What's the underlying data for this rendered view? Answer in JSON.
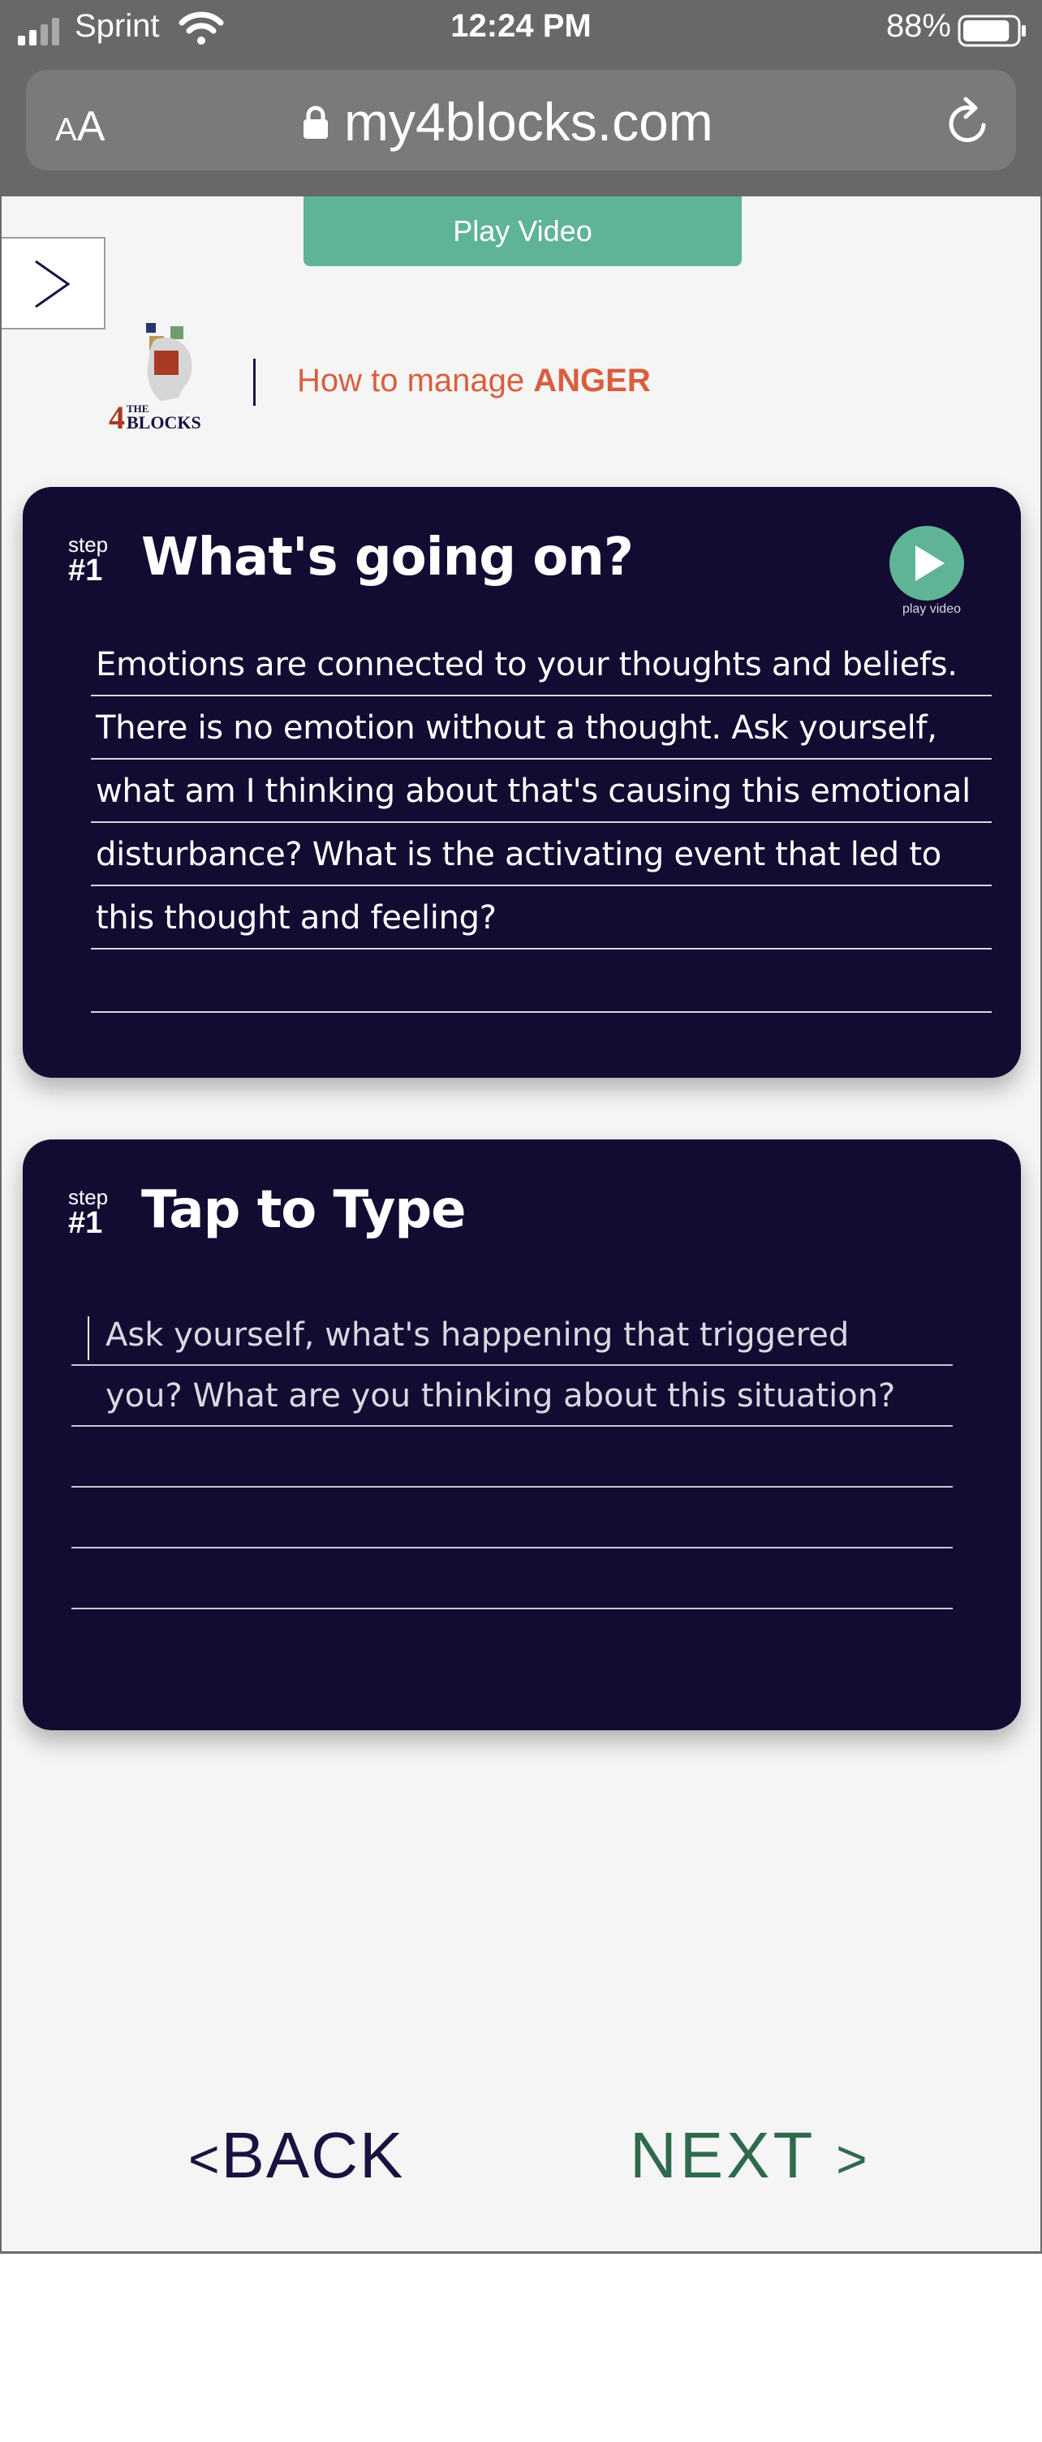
{
  "status_bar": {
    "carrier": "Sprint",
    "time": "12:24 PM",
    "battery_percent": "88%",
    "battery_level": 0.88,
    "signal_icon": "signal-bars-icon",
    "wifi_icon": "wifi-icon",
    "battery_icon": "battery-icon"
  },
  "browser": {
    "text_size_label_small": "A",
    "text_size_label_big": "A",
    "url": "my4blocks.com",
    "lock_icon": "lock-icon",
    "reload_icon": "reload-icon"
  },
  "page": {
    "play_video_label": "Play Video",
    "menu_toggle_icon": "chevron-right-icon",
    "logo_text_the": "THE",
    "logo_text_number": "4",
    "logo_text_blocks": "BLOCKS",
    "header_title_prefix": "How to manage ",
    "header_title_emphasis": "ANGER",
    "accent_color": "#d85f3e",
    "card_color": "#120c33",
    "green_color": "#5fb495"
  },
  "card_info": {
    "step_word": "step",
    "step_number": "#1",
    "title": "What's going on?",
    "play_caption": "play video",
    "body": "Emotions are connected to your thoughts and beliefs. There is no emotion without a thought. Ask yourself, what am I thinking about that's causing this emotional disturbance? What is the activating event that led to this thought and feeling?"
  },
  "card_input": {
    "step_word": "step",
    "step_number": "#1",
    "title": "Tap to Type",
    "placeholder": "Ask yourself, what's happening that triggered you? What are you thinking about this situation?"
  },
  "nav": {
    "back_chevron": "<",
    "back_label": "BACK",
    "next_label": "NEXT",
    "next_chevron": ">"
  }
}
